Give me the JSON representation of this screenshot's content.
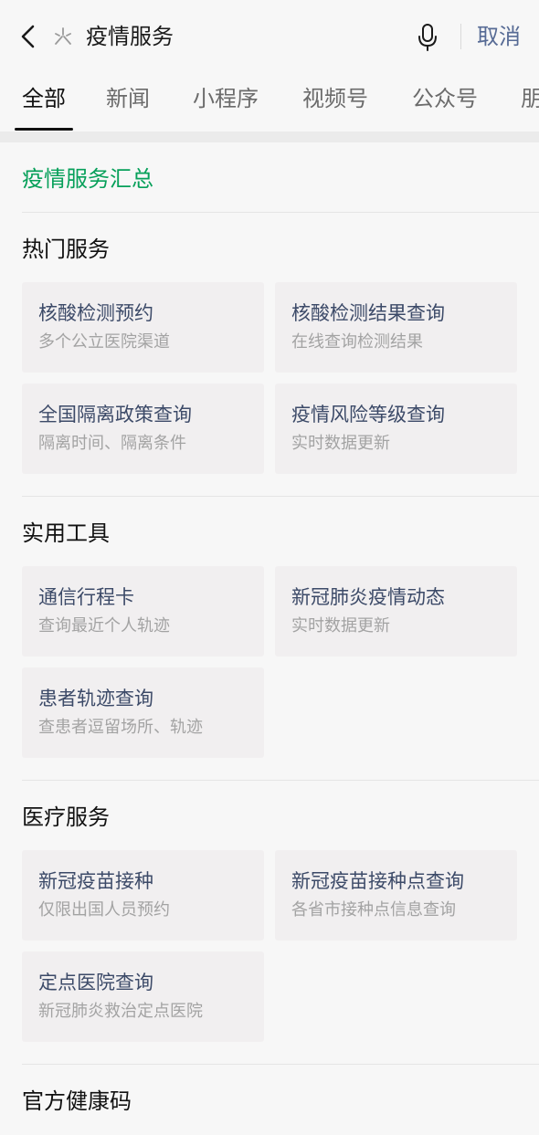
{
  "search": {
    "query": "疫情服务",
    "cancel_label": "取消"
  },
  "tabs": [
    {
      "label": "全部",
      "active": true
    },
    {
      "label": "新闻"
    },
    {
      "label": "小程序"
    },
    {
      "label": "视频号"
    },
    {
      "label": "公众号"
    },
    {
      "label": "朋"
    }
  ],
  "summary": {
    "title": "疫情服务汇总"
  },
  "sections": [
    {
      "title": "热门服务",
      "cards": [
        {
          "title": "核酸检测预约",
          "subtitle": "多个公立医院渠道"
        },
        {
          "title": "核酸检测结果查询",
          "subtitle": "在线查询检测结果"
        },
        {
          "title": "全国隔离政策查询",
          "subtitle": "隔离时间、隔离条件"
        },
        {
          "title": "疫情风险等级查询",
          "subtitle": "实时数据更新"
        }
      ]
    },
    {
      "title": "实用工具",
      "cards": [
        {
          "title": "通信行程卡",
          "subtitle": "查询最近个人轨迹"
        },
        {
          "title": "新冠肺炎疫情动态",
          "subtitle": "实时数据更新"
        },
        {
          "title": "患者轨迹查询",
          "subtitle": "查患者逗留场所、轨迹"
        }
      ]
    },
    {
      "title": "医疗服务",
      "cards": [
        {
          "title": "新冠疫苗接种",
          "subtitle": "仅限出国人员预约"
        },
        {
          "title": "新冠疫苗接种点查询",
          "subtitle": "各省市接种点信息查询"
        },
        {
          "title": "定点医院查询",
          "subtitle": "新冠肺炎救治定点医院"
        }
      ]
    },
    {
      "title": "官方健康码"
    }
  ],
  "colors": {
    "accent_green": "#07a05a",
    "link_blue": "#576b95",
    "card_title": "#3c4a68",
    "card_subtitle": "#a3a3a3",
    "card_bg": "#f1eff0",
    "page_bg": "#f7f7f7"
  },
  "icons": {
    "back": "back-chevron-icon",
    "spark": "search-spark-icon",
    "mic": "microphone-icon"
  }
}
